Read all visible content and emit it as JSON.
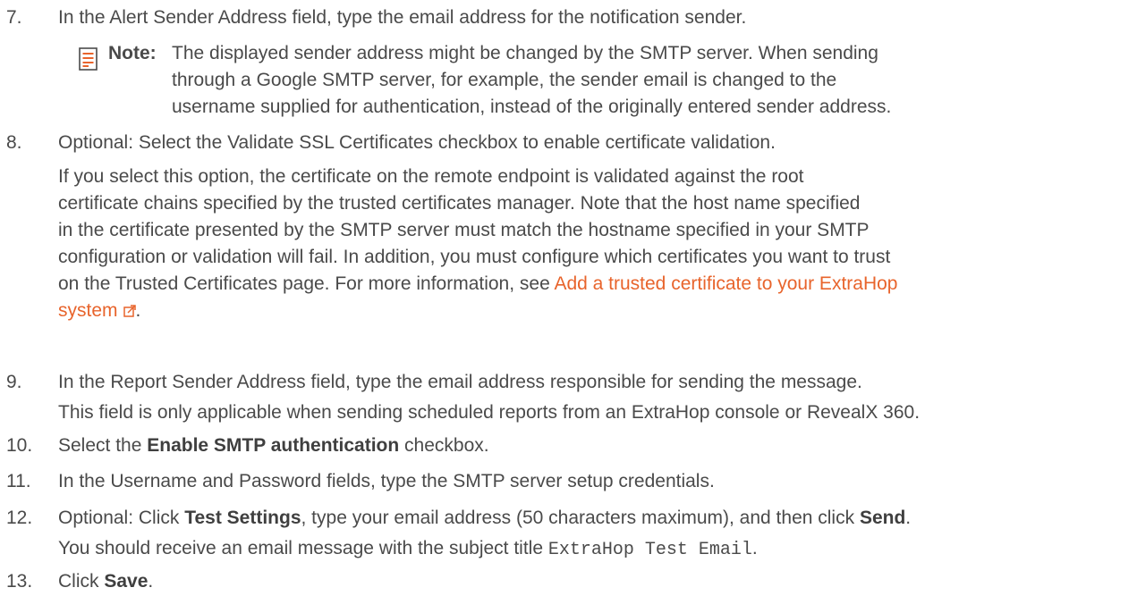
{
  "steps": {
    "s7": {
      "number": "7.",
      "text": "In the Alert Sender Address field, type the email address for the notification sender."
    },
    "note": {
      "label": "Note:",
      "icon": "note-icon",
      "lines": [
        "The displayed sender address might be changed by the SMTP server. When sending",
        "through a Google SMTP server, for example, the sender email is changed to the",
        "username supplied for authentication, instead of the originally entered sender address."
      ]
    },
    "s8": {
      "number": "8.",
      "text": "Optional: Select the Validate SSL Certificates checkbox to enable certificate validation.",
      "detail_lines": [
        "If you select this option, the certificate on the remote endpoint is validated against the root",
        "certificate chains specified by the trusted certificates manager. Note that the host name specified",
        "in the certificate presented by the SMTP server must match the hostname specified in your SMTP",
        "configuration or validation will fail. In addition, you must configure which certificates you want to trust",
        "on the Trusted Certificates page. For more information, see "
      ],
      "link_part1": "Add a trusted certificate to your ExtraHop",
      "link_part2": "system",
      "link_suffix": ".",
      "link_icon": "external-link-icon"
    },
    "s9": {
      "number": "9.",
      "text": "In the Report Sender Address field, type the email address responsible for sending the message.",
      "detail": "This field is only applicable when sending scheduled reports from an ExtraHop console or RevealX 360."
    },
    "s10": {
      "number": "10.",
      "prefix": "Select the ",
      "bold": "Enable SMTP authentication",
      "suffix": " checkbox."
    },
    "s11": {
      "number": "11.",
      "text": "In the Username and Password fields, type the SMTP server setup credentials."
    },
    "s12": {
      "number": "12.",
      "prefix": "Optional: Click ",
      "bold1": "Test Settings",
      "middle": ", type your email address (50 characters maximum), and then click ",
      "bold2": "Send",
      "suffix": ".",
      "detail_prefix": "You should receive an email message with the subject title ",
      "detail_code": "ExtraHop Test Email",
      "detail_suffix": "."
    },
    "s13": {
      "number": "13.",
      "prefix": "Click ",
      "bold": "Save",
      "suffix": "."
    }
  },
  "colors": {
    "text": "#4a4a4a",
    "link": "#e8642c",
    "note_icon": "#e8642c"
  }
}
